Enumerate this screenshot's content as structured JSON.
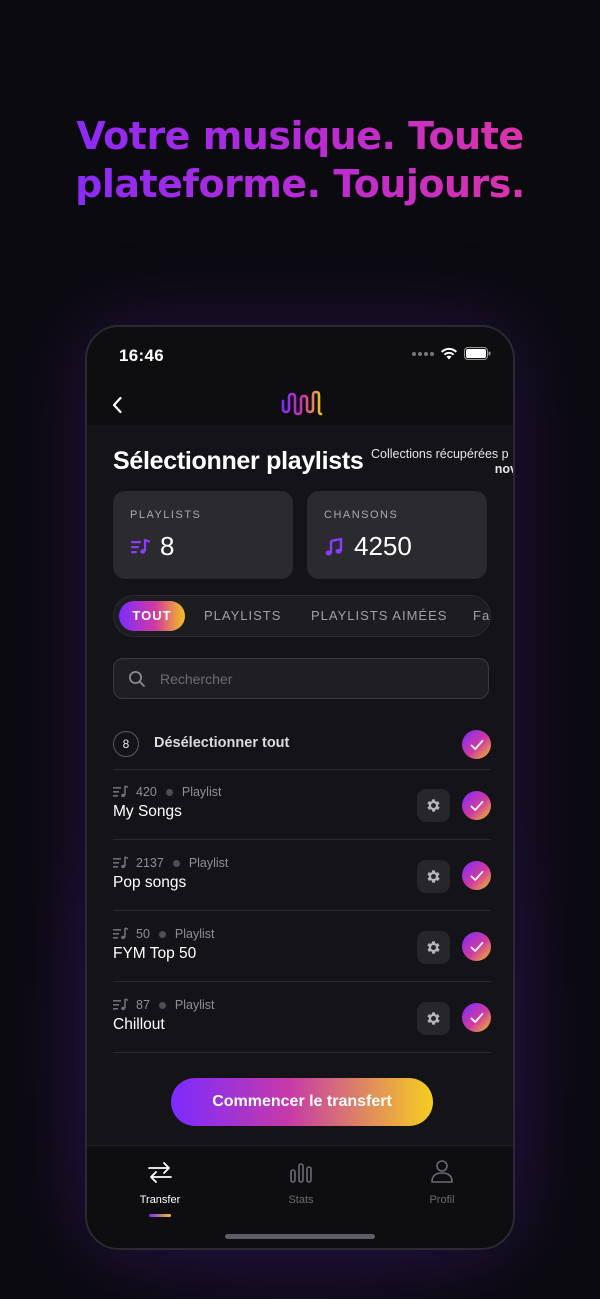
{
  "headline": {
    "line1_a": "Votre musique. Toute",
    "line2": "plateforme. Toujours."
  },
  "status_bar": {
    "time": "16:46"
  },
  "header": {
    "logo_icon": "waveform-logo-icon",
    "back_icon": "chevron-left-icon"
  },
  "page": {
    "title": "Sélectionner playlists",
    "subtitle_line1": "Collections récupérées p",
    "subtitle_line2": "nov"
  },
  "stats": {
    "playlists_label": "PLAYLISTS",
    "playlists_value": "8",
    "songs_label": "CHANSONS",
    "songs_value": "4250"
  },
  "tabs": [
    "TOUT",
    "PLAYLISTS",
    "PLAYLISTS AIMÉES",
    "Fa"
  ],
  "search": {
    "placeholder": "Rechercher"
  },
  "select_all": {
    "count": "8",
    "label": "Désélectionner tout"
  },
  "playlists": [
    {
      "count": "420",
      "type": "Playlist",
      "name": "My Songs"
    },
    {
      "count": "2137",
      "type": "Playlist",
      "name": "Pop songs"
    },
    {
      "count": "50",
      "type": "Playlist",
      "name": "FYM Top 50"
    },
    {
      "count": "87",
      "type": "Playlist",
      "name": "Chillout"
    }
  ],
  "cta_label": "Commencer le transfert",
  "tab_bar": {
    "transfer": "Transfer",
    "stats": "Stats",
    "profile": "Profil"
  },
  "colors": {
    "accent_purple": "#7c2bff",
    "accent_pink": "#d13aa0",
    "accent_yellow": "#f4c21f",
    "background": "#0b0a0f"
  }
}
